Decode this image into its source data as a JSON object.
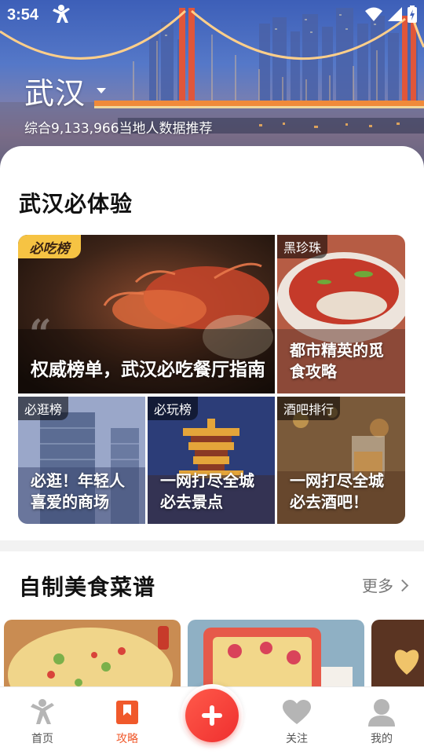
{
  "status_bar": {
    "time": "3:54",
    "icons": [
      "app-notification-icon",
      "wifi-icon",
      "signal-icon",
      "battery-charging-icon"
    ]
  },
  "hero": {
    "city": "武汉",
    "subtitle": "综合9,133,966当地人数据推荐",
    "image": "bridge-skyline-photo"
  },
  "experience_section": {
    "title": "武汉必体验",
    "tiles": [
      {
        "tag": "必吃榜",
        "text": "权威榜单，武汉必吃餐厅指南",
        "image": "crayfish-photo"
      },
      {
        "tag": "黑珍珠",
        "text": "都市精英的觅食攻略",
        "image": "spicy-dish-photo"
      },
      {
        "tag": "必逛榜",
        "text": "必逛！年轻人喜爱的商场",
        "image": "skyscraper-photo"
      },
      {
        "tag": "必玩榜",
        "text": "一网打尽全城必去景点",
        "image": "yellow-crane-tower-photo"
      },
      {
        "tag": "酒吧排行",
        "text": "一网打尽全城必去酒吧！",
        "image": "cocktail-bar-photo"
      }
    ]
  },
  "recipe_section": {
    "title": "自制美食菜谱",
    "more_label": "更多",
    "recipes": [
      "pizza-photo",
      "baked-dish-photo",
      "heart-cake-photo"
    ]
  },
  "bottom_nav": {
    "items": [
      {
        "label": "首页",
        "icon": "home-mascot-icon",
        "active": false
      },
      {
        "label": "攻略",
        "icon": "bookmark-icon",
        "active": true
      },
      {
        "label": "",
        "icon": "plus-icon",
        "active": false
      },
      {
        "label": "关注",
        "icon": "heart-icon",
        "active": false
      },
      {
        "label": "我的",
        "icon": "profile-icon",
        "active": false
      }
    ]
  },
  "colors": {
    "accent": "#f0592b",
    "fab": "#ef2f2f",
    "badge": "#f6c343"
  }
}
